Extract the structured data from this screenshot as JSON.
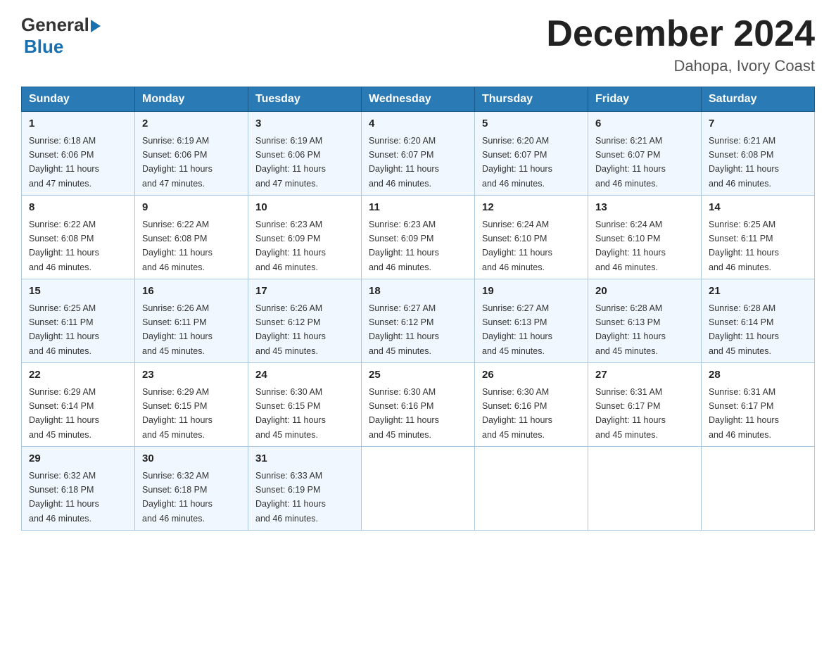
{
  "logo": {
    "general": "General",
    "blue": "Blue",
    "arrow_color": "#1a6faf"
  },
  "header": {
    "month_title": "December 2024",
    "location": "Dahopa, Ivory Coast"
  },
  "weekdays": [
    "Sunday",
    "Monday",
    "Tuesday",
    "Wednesday",
    "Thursday",
    "Friday",
    "Saturday"
  ],
  "weeks": [
    [
      {
        "day": "1",
        "sunrise": "6:18 AM",
        "sunset": "6:06 PM",
        "daylight": "11 hours and 47 minutes."
      },
      {
        "day": "2",
        "sunrise": "6:19 AM",
        "sunset": "6:06 PM",
        "daylight": "11 hours and 47 minutes."
      },
      {
        "day": "3",
        "sunrise": "6:19 AM",
        "sunset": "6:06 PM",
        "daylight": "11 hours and 47 minutes."
      },
      {
        "day": "4",
        "sunrise": "6:20 AM",
        "sunset": "6:07 PM",
        "daylight": "11 hours and 46 minutes."
      },
      {
        "day": "5",
        "sunrise": "6:20 AM",
        "sunset": "6:07 PM",
        "daylight": "11 hours and 46 minutes."
      },
      {
        "day": "6",
        "sunrise": "6:21 AM",
        "sunset": "6:07 PM",
        "daylight": "11 hours and 46 minutes."
      },
      {
        "day": "7",
        "sunrise": "6:21 AM",
        "sunset": "6:08 PM",
        "daylight": "11 hours and 46 minutes."
      }
    ],
    [
      {
        "day": "8",
        "sunrise": "6:22 AM",
        "sunset": "6:08 PM",
        "daylight": "11 hours and 46 minutes."
      },
      {
        "day": "9",
        "sunrise": "6:22 AM",
        "sunset": "6:08 PM",
        "daylight": "11 hours and 46 minutes."
      },
      {
        "day": "10",
        "sunrise": "6:23 AM",
        "sunset": "6:09 PM",
        "daylight": "11 hours and 46 minutes."
      },
      {
        "day": "11",
        "sunrise": "6:23 AM",
        "sunset": "6:09 PM",
        "daylight": "11 hours and 46 minutes."
      },
      {
        "day": "12",
        "sunrise": "6:24 AM",
        "sunset": "6:10 PM",
        "daylight": "11 hours and 46 minutes."
      },
      {
        "day": "13",
        "sunrise": "6:24 AM",
        "sunset": "6:10 PM",
        "daylight": "11 hours and 46 minutes."
      },
      {
        "day": "14",
        "sunrise": "6:25 AM",
        "sunset": "6:11 PM",
        "daylight": "11 hours and 46 minutes."
      }
    ],
    [
      {
        "day": "15",
        "sunrise": "6:25 AM",
        "sunset": "6:11 PM",
        "daylight": "11 hours and 46 minutes."
      },
      {
        "day": "16",
        "sunrise": "6:26 AM",
        "sunset": "6:11 PM",
        "daylight": "11 hours and 45 minutes."
      },
      {
        "day": "17",
        "sunrise": "6:26 AM",
        "sunset": "6:12 PM",
        "daylight": "11 hours and 45 minutes."
      },
      {
        "day": "18",
        "sunrise": "6:27 AM",
        "sunset": "6:12 PM",
        "daylight": "11 hours and 45 minutes."
      },
      {
        "day": "19",
        "sunrise": "6:27 AM",
        "sunset": "6:13 PM",
        "daylight": "11 hours and 45 minutes."
      },
      {
        "day": "20",
        "sunrise": "6:28 AM",
        "sunset": "6:13 PM",
        "daylight": "11 hours and 45 minutes."
      },
      {
        "day": "21",
        "sunrise": "6:28 AM",
        "sunset": "6:14 PM",
        "daylight": "11 hours and 45 minutes."
      }
    ],
    [
      {
        "day": "22",
        "sunrise": "6:29 AM",
        "sunset": "6:14 PM",
        "daylight": "11 hours and 45 minutes."
      },
      {
        "day": "23",
        "sunrise": "6:29 AM",
        "sunset": "6:15 PM",
        "daylight": "11 hours and 45 minutes."
      },
      {
        "day": "24",
        "sunrise": "6:30 AM",
        "sunset": "6:15 PM",
        "daylight": "11 hours and 45 minutes."
      },
      {
        "day": "25",
        "sunrise": "6:30 AM",
        "sunset": "6:16 PM",
        "daylight": "11 hours and 45 minutes."
      },
      {
        "day": "26",
        "sunrise": "6:30 AM",
        "sunset": "6:16 PM",
        "daylight": "11 hours and 45 minutes."
      },
      {
        "day": "27",
        "sunrise": "6:31 AM",
        "sunset": "6:17 PM",
        "daylight": "11 hours and 45 minutes."
      },
      {
        "day": "28",
        "sunrise": "6:31 AM",
        "sunset": "6:17 PM",
        "daylight": "11 hours and 46 minutes."
      }
    ],
    [
      {
        "day": "29",
        "sunrise": "6:32 AM",
        "sunset": "6:18 PM",
        "daylight": "11 hours and 46 minutes."
      },
      {
        "day": "30",
        "sunrise": "6:32 AM",
        "sunset": "6:18 PM",
        "daylight": "11 hours and 46 minutes."
      },
      {
        "day": "31",
        "sunrise": "6:33 AM",
        "sunset": "6:19 PM",
        "daylight": "11 hours and 46 minutes."
      },
      null,
      null,
      null,
      null
    ]
  ],
  "labels": {
    "sunrise": "Sunrise:",
    "sunset": "Sunset:",
    "daylight": "Daylight:"
  }
}
